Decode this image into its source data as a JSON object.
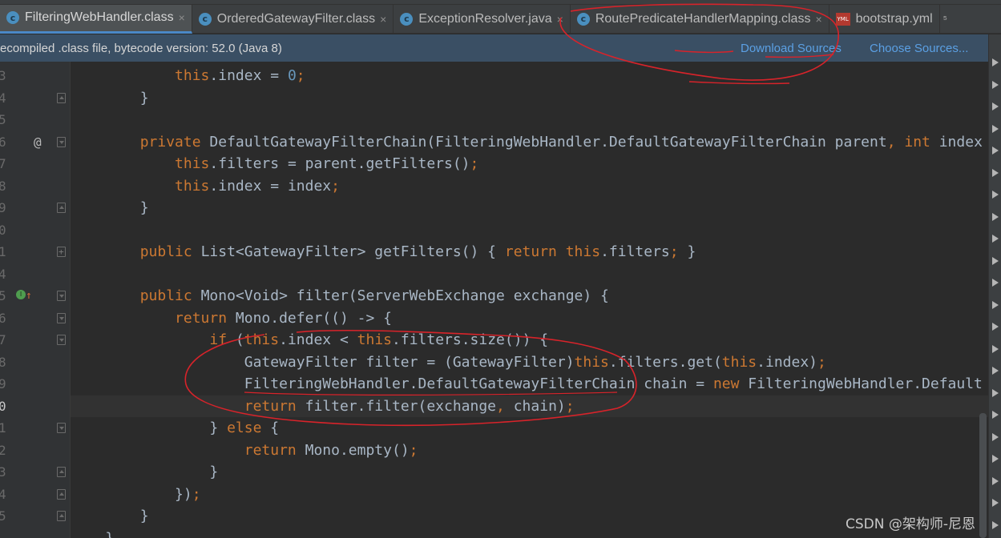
{
  "tabs": [
    {
      "label": "FilteringWebHandler.class",
      "icon": "class-icon",
      "active": true
    },
    {
      "label": "OrderedGatewayFilter.class",
      "icon": "class-icon",
      "active": false
    },
    {
      "label": "ExceptionResolver.java",
      "icon": "class-icon",
      "active": false
    },
    {
      "label": "RoutePredicateHandlerMapping.class",
      "icon": "class-icon",
      "active": false
    },
    {
      "label": "bootstrap.yml",
      "icon": "yml-icon",
      "active": false
    }
  ],
  "tab_close_glyph": "×",
  "tab_overflow": "⁵",
  "icon_letter_class": "c",
  "icon_letter_yml": "YML",
  "notice": {
    "message": "ecompiled .class file, bytecode version: 52.0 (Java 8)",
    "download_sources": "Download Sources",
    "choose_sources": "Choose Sources..."
  },
  "watermark": "CSDN @架构师-尼恩",
  "colors": {
    "keyword": "#cc7832",
    "text": "#a9b7c6",
    "number": "#6897bb",
    "link": "#5ba0e4",
    "annotation": "#d8232a"
  },
  "code_lines": [
    {
      "num": "3",
      "fold": "",
      "marker": "",
      "tokens": [
        [
          "tx",
          "            "
        ],
        [
          "kw",
          "this"
        ],
        [
          "tx",
          ".index = "
        ],
        [
          "num",
          "0"
        ],
        [
          "kw",
          ";"
        ]
      ]
    },
    {
      "num": "4",
      "fold": "up",
      "marker": "",
      "tokens": [
        [
          "tx",
          "        }"
        ]
      ]
    },
    {
      "num": "5",
      "fold": "",
      "marker": "",
      "tokens": []
    },
    {
      "num": "6",
      "fold": "down",
      "marker": "at",
      "tokens": [
        [
          "tx",
          "        "
        ],
        [
          "kw",
          "private "
        ],
        [
          "tx",
          "DefaultGatewayFilterChain(FilteringWebHandler.DefaultGatewayFilterChain parent"
        ],
        [
          "kw",
          ", int "
        ],
        [
          "tx",
          "index"
        ]
      ]
    },
    {
      "num": "7",
      "fold": "",
      "marker": "",
      "tokens": [
        [
          "tx",
          "            "
        ],
        [
          "kw",
          "this"
        ],
        [
          "tx",
          ".filters = parent.getFilters()"
        ],
        [
          "kw",
          ";"
        ]
      ]
    },
    {
      "num": "8",
      "fold": "",
      "marker": "",
      "tokens": [
        [
          "tx",
          "            "
        ],
        [
          "kw",
          "this"
        ],
        [
          "tx",
          ".index = index"
        ],
        [
          "kw",
          ";"
        ]
      ]
    },
    {
      "num": "9",
      "fold": "up",
      "marker": "",
      "tokens": [
        [
          "tx",
          "        }"
        ]
      ]
    },
    {
      "num": "0",
      "fold": "",
      "marker": "",
      "tokens": []
    },
    {
      "num": "1",
      "fold": "plus",
      "marker": "",
      "tokens": [
        [
          "tx",
          "        "
        ],
        [
          "kw",
          "public "
        ],
        [
          "tx",
          "List<GatewayFilter> getFilters() { "
        ],
        [
          "kw",
          "return this"
        ],
        [
          "tx",
          ".filters"
        ],
        [
          "kw",
          ";"
        ],
        [
          "tx",
          " }"
        ]
      ]
    },
    {
      "num": "4",
      "fold": "",
      "marker": "",
      "tokens": []
    },
    {
      "num": "5",
      "fold": "down",
      "marker": "impl",
      "tokens": [
        [
          "tx",
          "        "
        ],
        [
          "kw",
          "public "
        ],
        [
          "tx",
          "Mono<Void> filter(ServerWebExchange exchange) {"
        ]
      ]
    },
    {
      "num": "6",
      "fold": "down",
      "marker": "",
      "tokens": [
        [
          "tx",
          "            "
        ],
        [
          "kw",
          "return "
        ],
        [
          "tx",
          "Mono.defer(() -> {"
        ]
      ]
    },
    {
      "num": "7",
      "fold": "down",
      "marker": "",
      "tokens": [
        [
          "tx",
          "                "
        ],
        [
          "kw",
          "if "
        ],
        [
          "tx",
          "("
        ],
        [
          "kw",
          "this"
        ],
        [
          "tx",
          ".index < "
        ],
        [
          "kw",
          "this"
        ],
        [
          "tx",
          ".filters.size()) {"
        ]
      ]
    },
    {
      "num": "8",
      "fold": "",
      "marker": "",
      "tokens": [
        [
          "tx",
          "                    GatewayFilter filter = (GatewayFilter)"
        ],
        [
          "kw",
          "this"
        ],
        [
          "tx",
          ".filters.get("
        ],
        [
          "kw",
          "this"
        ],
        [
          "tx",
          ".index)"
        ],
        [
          "kw",
          ";"
        ]
      ]
    },
    {
      "num": "9",
      "fold": "",
      "marker": "",
      "tokens": [
        [
          "tx",
          "                    FilteringWebHandler.DefaultGatewayFilterChain chain = "
        ],
        [
          "kw",
          "new "
        ],
        [
          "tx",
          "FilteringWebHandler.Default"
        ]
      ]
    },
    {
      "num": "0",
      "fold": "",
      "marker": "",
      "current": true,
      "tokens": [
        [
          "tx",
          "                    "
        ],
        [
          "kw",
          "return "
        ],
        [
          "tx",
          "filter.filter(exchange"
        ],
        [
          "kw",
          ", "
        ],
        [
          "tx",
          "chain)"
        ],
        [
          "kw",
          ";"
        ]
      ]
    },
    {
      "num": "1",
      "fold": "down",
      "marker": "",
      "tokens": [
        [
          "tx",
          "                } "
        ],
        [
          "kw",
          "else "
        ],
        [
          "tx",
          "{"
        ]
      ]
    },
    {
      "num": "2",
      "fold": "",
      "marker": "",
      "tokens": [
        [
          "tx",
          "                    "
        ],
        [
          "kw",
          "return "
        ],
        [
          "tx",
          "Mono.empty()"
        ],
        [
          "kw",
          ";"
        ]
      ]
    },
    {
      "num": "3",
      "fold": "up",
      "marker": "",
      "tokens": [
        [
          "tx",
          "                }"
        ]
      ]
    },
    {
      "num": "4",
      "fold": "up",
      "marker": "",
      "tokens": [
        [
          "tx",
          "            })"
        ],
        [
          "kw",
          ";"
        ]
      ]
    },
    {
      "num": "5",
      "fold": "up",
      "marker": "",
      "tokens": [
        [
          "tx",
          "        }"
        ]
      ]
    },
    {
      "num": "",
      "fold": "",
      "marker": "",
      "tokens": [
        [
          "tx",
          "    }"
        ]
      ]
    }
  ]
}
